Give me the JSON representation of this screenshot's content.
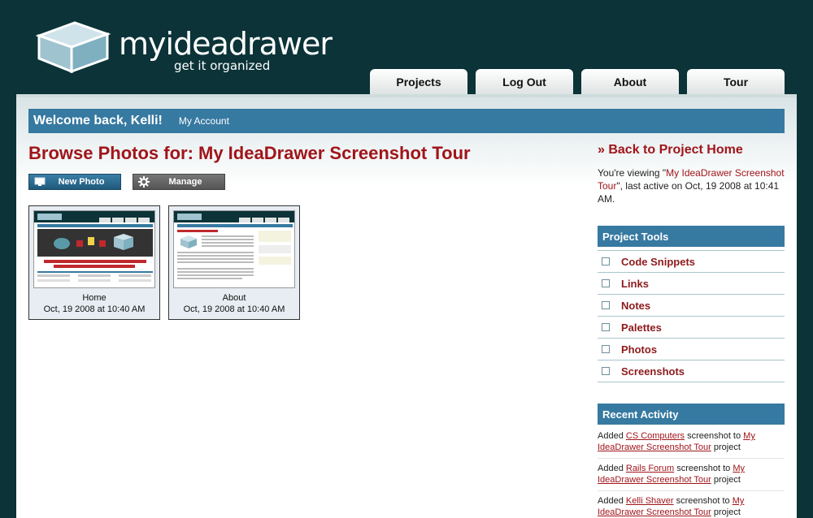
{
  "brand": {
    "name": "myideadrawer",
    "tagline": "get it organized"
  },
  "nav": {
    "tabs": [
      "Projects",
      "Log Out",
      "About",
      "Tour"
    ]
  },
  "welcome": {
    "message": "Welcome back, Kelli!",
    "account_link": "My Account"
  },
  "page": {
    "title": "Browse Photos for: My IdeaDrawer Screenshot Tour",
    "new_photo_label": "New Photo",
    "manage_label": "Manage"
  },
  "photos": [
    {
      "name": "Home",
      "date": "Oct, 19 2008 at 10:40 AM"
    },
    {
      "name": "About",
      "date": "Oct, 19 2008 at 10:40 AM"
    }
  ],
  "sidebar": {
    "back_link": "» Back to Project Home",
    "viewing_prefix": "You're viewing \"",
    "viewing_project": "My IdeaDrawer Screenshot Tour",
    "viewing_suffix": "\", last active on Oct, 19 2008 at 10:41 AM.",
    "tools_title": "Project Tools",
    "tools": [
      "Code Snippets",
      "Links",
      "Notes",
      "Palettes",
      "Photos",
      "Screenshots"
    ],
    "activity_title": "Recent Activity",
    "activity": [
      {
        "prefix": "Added ",
        "item": "CS Computers",
        "middle": " screenshot to ",
        "project": "My IdeaDrawer Screenshot Tour",
        "suffix": " project"
      },
      {
        "prefix": "Added ",
        "item": "Rails Forum",
        "middle": " screenshot to ",
        "project": "My IdeaDrawer Screenshot Tour",
        "suffix": " project"
      },
      {
        "prefix": "Added ",
        "item": "Kelli Shaver",
        "middle": " screenshot to ",
        "project": "My IdeaDrawer Screenshot Tour",
        "suffix": " project"
      }
    ]
  },
  "colors": {
    "header_bg": "#0b3338",
    "accent_blue": "#3679a1",
    "title_red": "#a0151a"
  }
}
